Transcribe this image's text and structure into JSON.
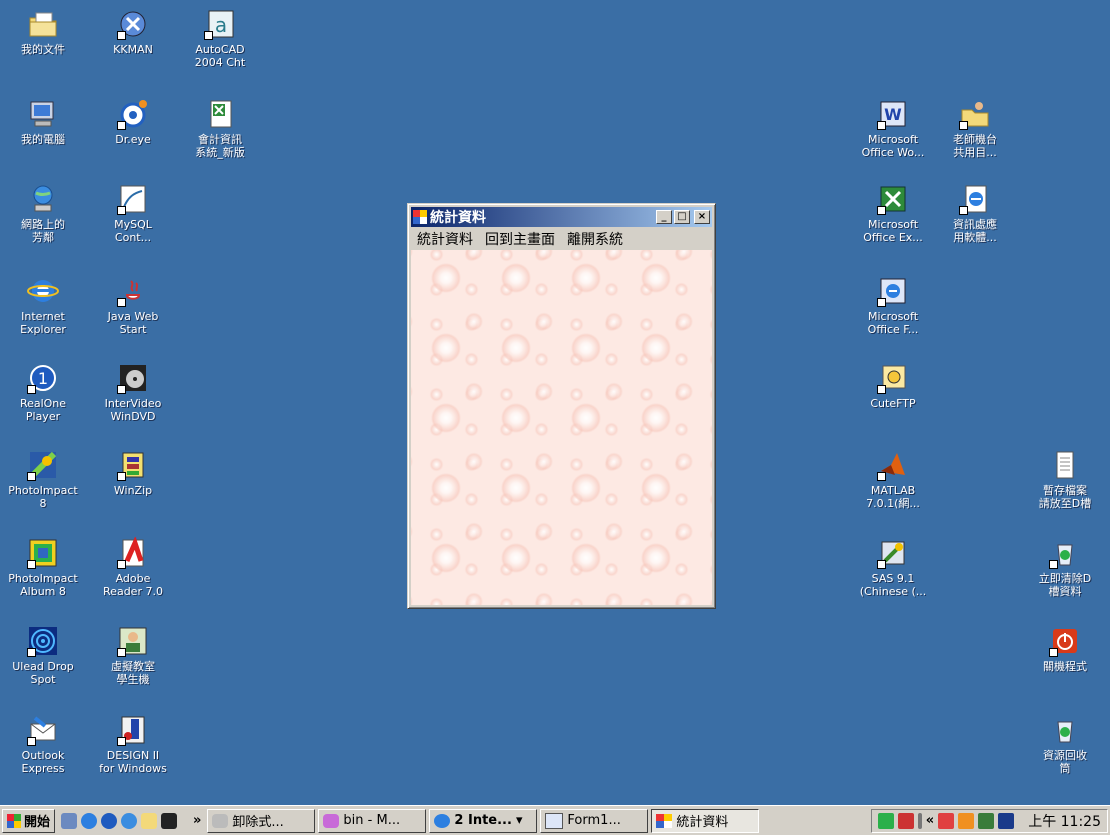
{
  "desktop": {
    "icons": [
      {
        "label": "我的文件",
        "icon": "my-documents-icon"
      },
      {
        "label": "KKMAN",
        "icon": "kkman-icon"
      },
      {
        "label": "AutoCAD\n2004 Cht",
        "icon": "autocad-icon"
      },
      {
        "label": "我的電腦",
        "icon": "my-computer-icon"
      },
      {
        "label": "Dr.eye",
        "icon": "dreye-icon"
      },
      {
        "label": "會計資訊\n系統_新版",
        "icon": "excel-file-icon"
      },
      {
        "label": "網路上的\n芳鄰",
        "icon": "network-icon"
      },
      {
        "label": "MySQL\nCont...",
        "icon": "mysql-icon"
      },
      {
        "label": "Internet\nExplorer",
        "icon": "ie-icon"
      },
      {
        "label": "Java Web\nStart",
        "icon": "java-icon"
      },
      {
        "label": "RealOne\nPlayer",
        "icon": "realone-icon"
      },
      {
        "label": "InterVideo\nWinDVD",
        "icon": "windvd-icon"
      },
      {
        "label": "PhotoImpact\n8",
        "icon": "photoimpact-icon"
      },
      {
        "label": "WinZip",
        "icon": "winzip-icon"
      },
      {
        "label": "PhotoImpact\nAlbum 8",
        "icon": "photoimpact-album-icon"
      },
      {
        "label": "Adobe\nReader 7.0",
        "icon": "adobe-reader-icon"
      },
      {
        "label": "Ulead Drop\nSpot",
        "icon": "ulead-dropspot-icon"
      },
      {
        "label": "虛擬教室\n學生機",
        "icon": "virtual-classroom-icon"
      },
      {
        "label": "Outlook\nExpress",
        "icon": "outlook-express-icon"
      },
      {
        "label": "DESIGN II\nfor Windows",
        "icon": "design2-icon"
      },
      {
        "label": "Microsoft\nOffice Wo...",
        "icon": "word-icon"
      },
      {
        "label": "老師機台\n共用目...",
        "icon": "shared-folder-icon"
      },
      {
        "label": "Microsoft\nOffice Ex...",
        "icon": "excel-icon"
      },
      {
        "label": "資訊處應\n用軟體...",
        "icon": "ie-document-icon"
      },
      {
        "label": "Microsoft\nOffice F...",
        "icon": "frontpage-icon"
      },
      {
        "label": "CuteFTP",
        "icon": "cuteftp-icon"
      },
      {
        "label": "MATLAB\n7.0.1(網...",
        "icon": "matlab-icon"
      },
      {
        "label": "暫存檔案\n請放至D槽",
        "icon": "text-file-icon"
      },
      {
        "label": "SAS 9.1\n(Chinese (...",
        "icon": "sas-icon"
      },
      {
        "label": "立即清除D\n槽資料",
        "icon": "recycle-icon"
      },
      {
        "label": "關機程式",
        "icon": "shutdown-icon"
      },
      {
        "label": "資源回收\n筒",
        "icon": "recycle-bin-icon"
      }
    ]
  },
  "window": {
    "title": "統計資料",
    "menu": [
      "統計資料",
      "回到主畫面",
      "離開系統"
    ],
    "minimize": "_",
    "maximize": "□",
    "close": "×"
  },
  "taskbar": {
    "start": "開始",
    "chevron": "»",
    "buttons": [
      {
        "label": "卸除式...",
        "active": false
      },
      {
        "label": "bin - M...",
        "active": false
      },
      {
        "label": "2 Inte...",
        "active": false
      },
      {
        "label": "Form1...",
        "active": false
      },
      {
        "label": "統計資料",
        "active": true
      }
    ],
    "tray_chevron": "«",
    "clock": "上午 11:25"
  },
  "colors": {
    "desktop": "#3a6ea5",
    "titlebar_start": "#0a246a",
    "titlebar_end": "#a6caf0"
  }
}
